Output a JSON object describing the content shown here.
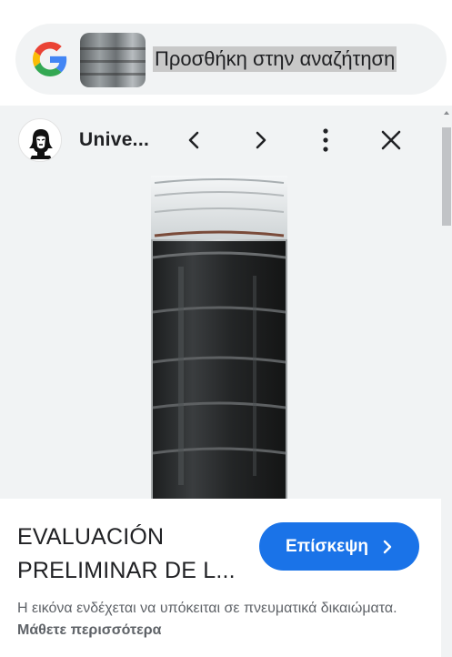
{
  "search": {
    "query_text": "Προσθήκη στην αναζήτηση",
    "logo_icon": "google-g-logo",
    "thumbnail": "bottle-thumbnail"
  },
  "source": {
    "name": "Unive...",
    "avatar_icon": "university-avatar-icon"
  },
  "toolbar": {
    "prev_icon": "chevron-left-icon",
    "next_icon": "chevron-right-icon",
    "more_icon": "more-vert-icon",
    "close_icon": "close-icon"
  },
  "result": {
    "title_line1": "EVALUACIÓN",
    "title_line2": "PRELIMINAR DE L...",
    "visit_label": "Επίσκεψη",
    "notice_text": "Η εικόνα ενδέχεται να υπόκειται σε πνευματικά δικαιώματα. ",
    "learn_more": "Μάθετε περισσότερα"
  },
  "colors": {
    "accent": "#1a73e8",
    "panel_bg": "#f1f3f4",
    "text": "#202124",
    "muted": "#5f6368"
  }
}
